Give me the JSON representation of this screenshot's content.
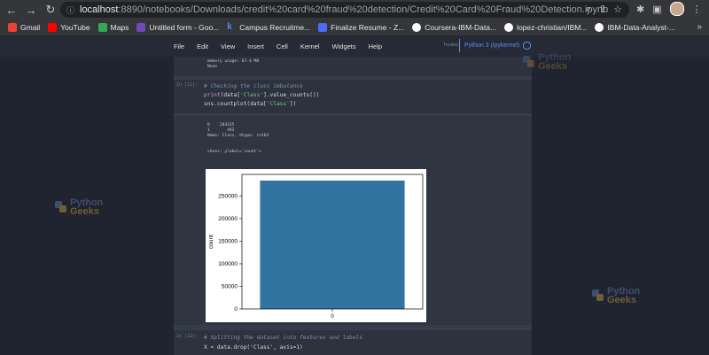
{
  "browser": {
    "url_host": "localhost",
    "url_rest": ":8890/notebooks/Downloads/credit%20card%20fraud%20detection/Credit%20Card%20Fraud%20Detection.ipynb",
    "bookmarks": [
      {
        "label": "Gmail",
        "icon": "gmail-icon",
        "color": "#ea4335"
      },
      {
        "label": "YouTube",
        "icon": "youtube-icon",
        "color": "#ff0000"
      },
      {
        "label": "Maps",
        "icon": "maps-icon",
        "color": "#34a853"
      },
      {
        "label": "Untitled form - Goo...",
        "icon": "forms-icon",
        "color": "#7248b9"
      },
      {
        "label": "Campus Recruitme...",
        "icon": "k-icon",
        "color": "#1a73e8"
      },
      {
        "label": "Finalize Resume - Z...",
        "icon": "zety-icon",
        "color": "#4a6cf7"
      },
      {
        "label": "Coursera-IBM-Data...",
        "icon": "github-icon",
        "color": "#ffffff"
      },
      {
        "label": "lopez-christian/IBM...",
        "icon": "github-icon",
        "color": "#ffffff"
      },
      {
        "label": "IBM-Data-Analyst-...",
        "icon": "github-icon",
        "color": "#ffffff"
      }
    ],
    "bookmarks_more": "»"
  },
  "jupyter": {
    "menu": [
      "File",
      "Edit",
      "View",
      "Insert",
      "Cell",
      "Kernel",
      "Widgets",
      "Help"
    ],
    "trusted": "Trusted",
    "kernel": "Python 3 (ipykernel)"
  },
  "cells": {
    "top_output": [
      "memory usage: 67.4 MB",
      "None"
    ],
    "cell1_prompt": "In [11]:",
    "cell1_comment": "# Checking the class imbalance",
    "cell1_line2_fn": "print",
    "cell1_line2_rest": "(data[",
    "cell1_line2_str": "'Class'",
    "cell1_line2_end": "].value_counts())",
    "cell1_line3_a": "sns.countplot(data[",
    "cell1_line3_str": "'Class'",
    "cell1_line3_end": "])",
    "cell1_out": [
      "0    284315",
      "1       492",
      "Name: Class, dtype: int64"
    ],
    "cell1_out_axes": "<Axes: ylabel='count'>",
    "cell2_prompt": "In [12]:",
    "cell2_comment": "# Splitting the dataset into features and labels",
    "cell2_line2": "X = data.drop('Class', axis=1)"
  },
  "watermark": {
    "python": "Python",
    "geeks": "Geeks"
  },
  "chart_data": {
    "type": "bar",
    "categories": [
      "0"
    ],
    "values": [
      284315
    ],
    "title": "",
    "xlabel": "",
    "ylabel": "count",
    "ylim": [
      0,
      298000
    ],
    "yticks": [
      0,
      50000,
      100000,
      150000,
      200000,
      250000
    ],
    "bar_color": "#3274a1"
  }
}
